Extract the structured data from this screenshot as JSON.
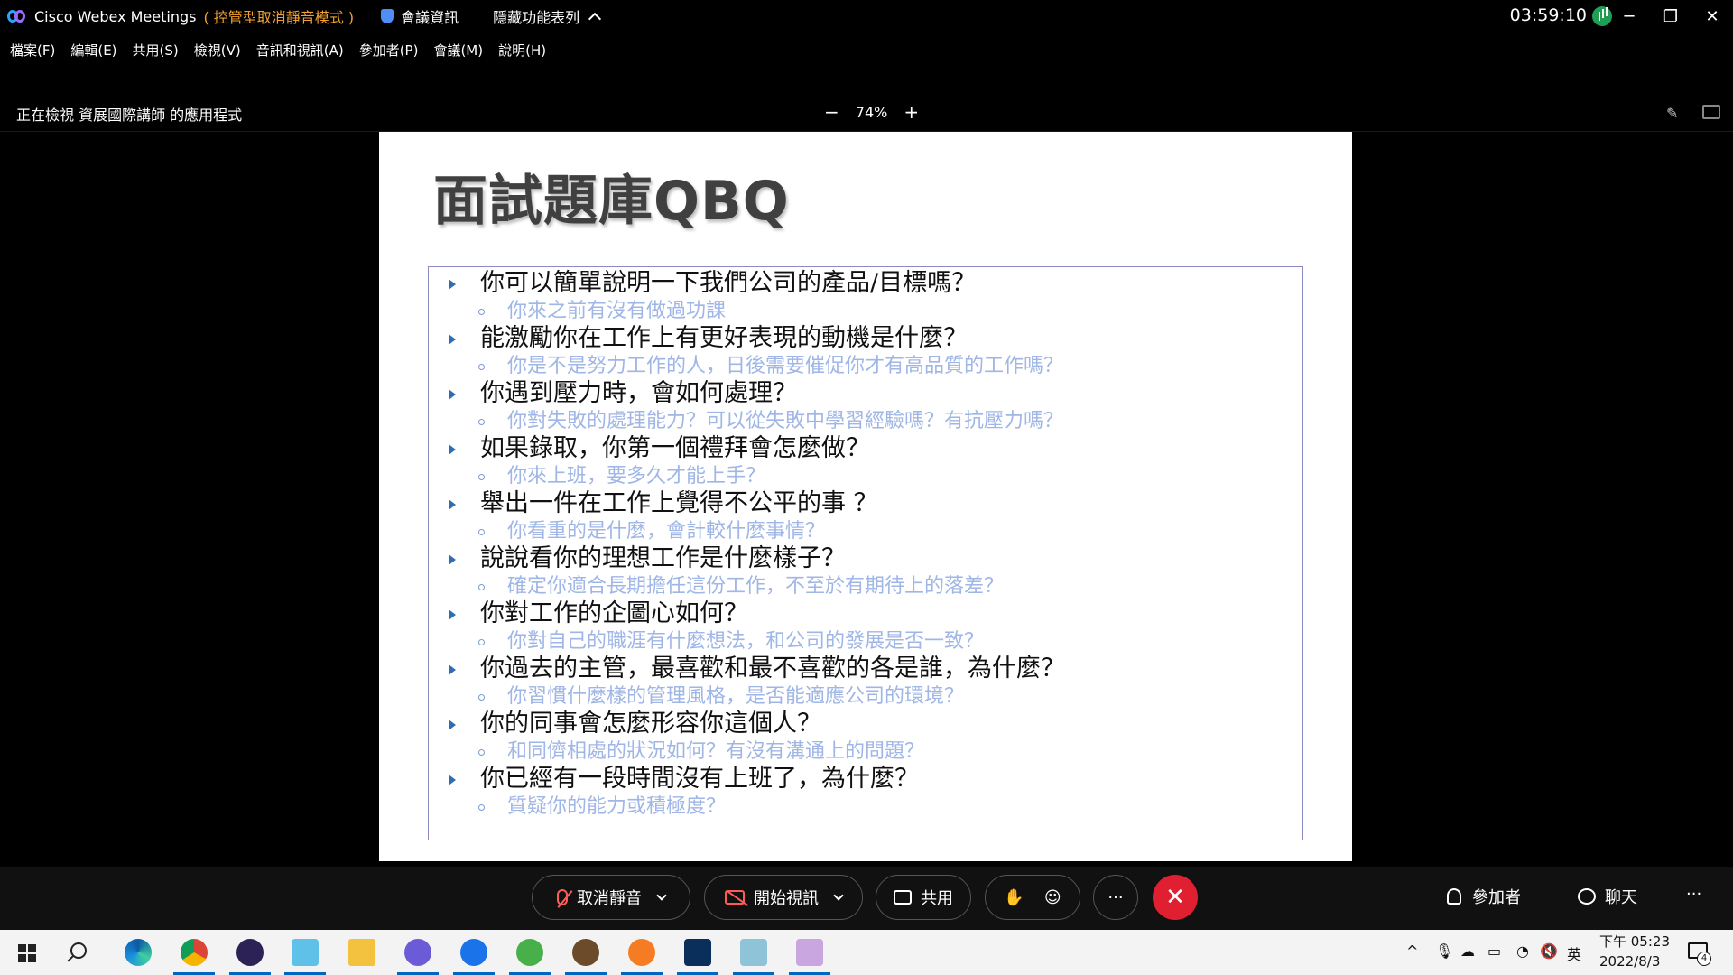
{
  "titlebar": {
    "app_name": "Cisco Webex Meetings",
    "mode": "( 控管型取消靜音模式 )",
    "meeting_info": "會議資訊",
    "hidden_features": "隱藏功能表列",
    "clock": "03:59:10",
    "minimize": "─",
    "restore": "❐",
    "close": "✕"
  },
  "menu": [
    "檔案(F)",
    "編輯(E)",
    "共用(S)",
    "檢視(V)",
    "音訊和視訊(A)",
    "參加者(P)",
    "會議(M)",
    "說明(H)"
  ],
  "viewbar": {
    "title": "正在檢視 資展國際講師 的應用程式",
    "zoom_out": "−",
    "zoom_level": "74%",
    "zoom_in": "+"
  },
  "slide": {
    "title": "面試題庫QBQ",
    "questions": [
      {
        "q": "你可以簡單說明一下我們公司的產品/目標嗎？",
        "sub": "你來之前有沒有做過功課"
      },
      {
        "q": "能激勵你在工作上有更好表現的動機是什麼？",
        "sub": "你是不是努力工作的人，日後需要催促你才有高品質的工作嗎？"
      },
      {
        "q": "你遇到壓力時，會如何處理？",
        "sub": "你對失敗的處理能力？可以從失敗中學習經驗嗎？有抗壓力嗎？"
      },
      {
        "q": "如果錄取，你第一個禮拜會怎麼做？",
        "sub": "你來上班，要多久才能上手？"
      },
      {
        "q": "舉出一件在工作上覺得不公平的事 ？",
        "sub": "你看重的是什麼，會計較什麼事情？"
      },
      {
        "q": "說說看你的理想工作是什麼樣子？",
        "sub": "確定你適合長期擔任這份工作，不至於有期待上的落差？"
      },
      {
        "q": "你對工作的企圖心如何？",
        "sub": "你對自己的職涯有什麼想法，和公司的發展是否一致？"
      },
      {
        "q": "你過去的主管，最喜歡和最不喜歡的各是誰，為什麼？",
        "sub": "你習慣什麼樣的管理風格，是否能適應公司的環境？"
      },
      {
        "q": "你的同事會怎麼形容你這個人？",
        "sub": "和同儕相處的狀況如何？有沒有溝通上的問題？"
      },
      {
        "q": "你已經有一段時間沒有上班了，為什麼？",
        "sub": "質疑你的能力或積極度？"
      }
    ]
  },
  "controls": {
    "unmute": "取消靜音",
    "start_video": "開始視訊",
    "share": "共用",
    "more": "···",
    "end": "✕",
    "participants": "參加者",
    "chat": "聊天",
    "overflow": "···"
  },
  "taskbar": {
    "tray_chevron": "^",
    "ime": "英",
    "time": "下午 05:23",
    "date": "2022/8/3",
    "notifications": "4"
  }
}
